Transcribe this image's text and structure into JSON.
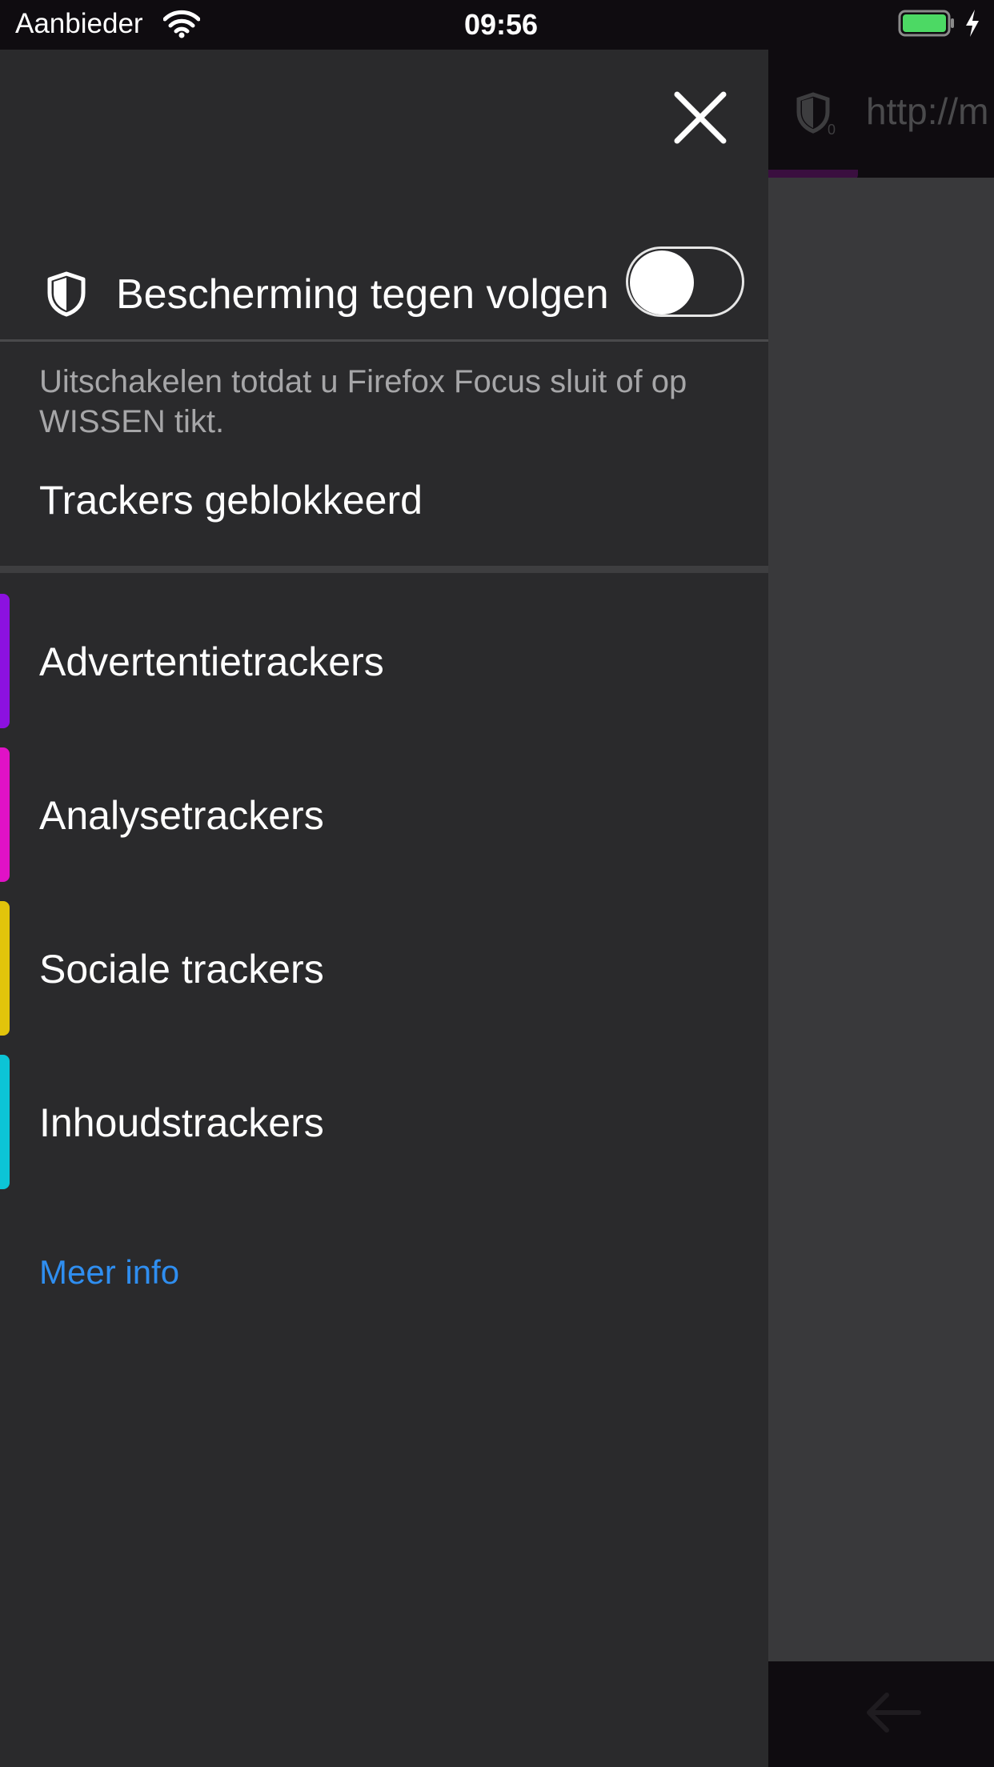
{
  "status_bar": {
    "carrier": "Aanbieder",
    "time": "09:56",
    "battery_color": "#4cd964"
  },
  "background_browser": {
    "url_fragment": "http://m",
    "shield_count": "0"
  },
  "drawer": {
    "tracking_protection": {
      "label": "Bescherming tegen volgen",
      "enabled": false
    },
    "description": "Uitschakelen totdat u Firefox Focus sluit of op WISSEN tikt.",
    "blocked_title": "Trackers geblokkeerd",
    "trackers": [
      {
        "label": "Advertentietrackers",
        "color": "#8c11e0"
      },
      {
        "label": "Analysetrackers",
        "color": "#e012c6"
      },
      {
        "label": "Sociale trackers",
        "color": "#e2c40b"
      },
      {
        "label": "Inhoudstrackers",
        "color": "#0cc4d6"
      }
    ],
    "more_info": "Meer info",
    "link_color": "#2f8ef0"
  }
}
